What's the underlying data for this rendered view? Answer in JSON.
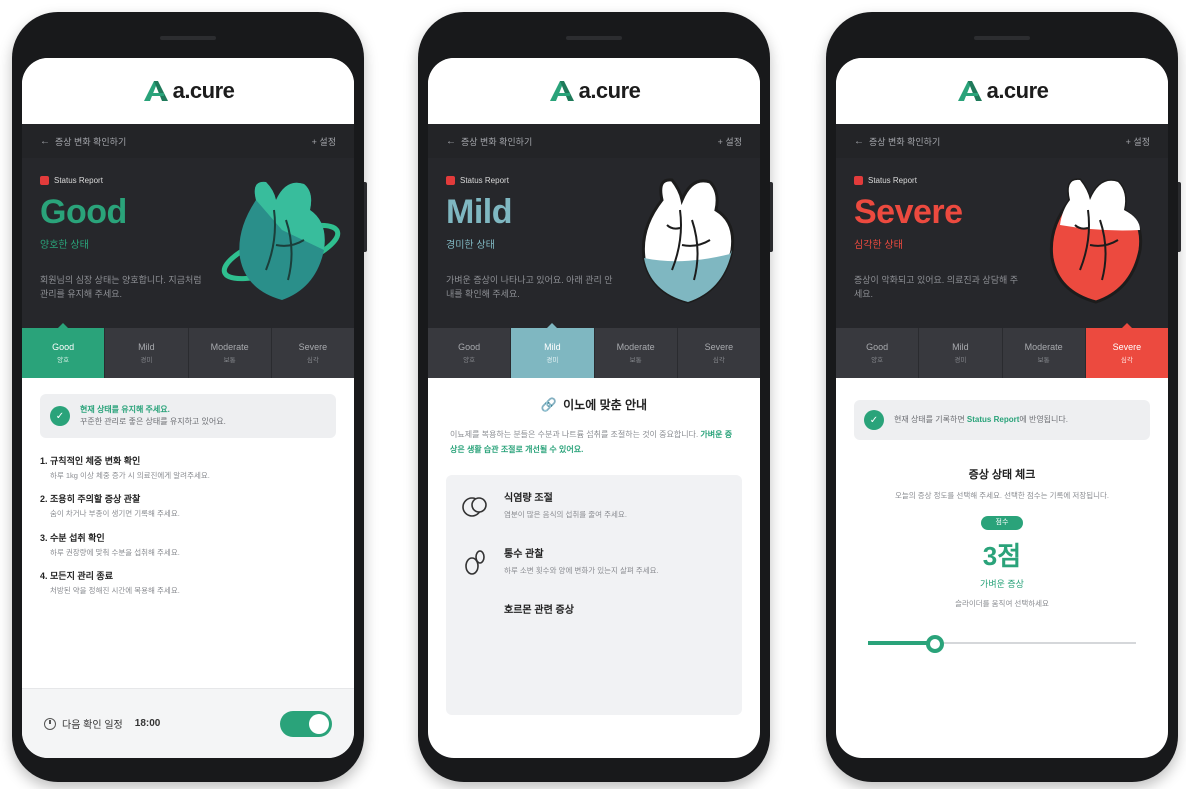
{
  "app": {
    "brand": "a.cure"
  },
  "phone1": {
    "nav_back": "증상 변화 확인하기",
    "nav_right": "+ 설정",
    "tag": "Status Report",
    "status": "Good",
    "status_sub": "양호한 상태",
    "desc": "회원님의 심장 상태는 양호합니다. 지금처럼 관리를 유지해 주세요.",
    "status_color": "#2aa37a",
    "segments": [
      {
        "label": "Good",
        "sub": "양호"
      },
      {
        "label": "Mild",
        "sub": "경미"
      },
      {
        "label": "Moderate",
        "sub": "보통"
      },
      {
        "label": "Severe",
        "sub": "심각"
      }
    ],
    "notice_title": "현재 상태를 유지해 주세요.",
    "notice_body": "꾸준한 관리로 좋은 상태를 유지하고 있어요.",
    "steps": [
      {
        "title": "1. 규칙적인 체중 변화 확인",
        "desc": "하루 1kg 이상 체중 증가 시 의료진에게 알려주세요."
      },
      {
        "title": "2. 조용히 주의할 증상 관찰",
        "desc": "숨이 차거나 부종이 생기면 기록해 주세요."
      },
      {
        "title": "3. 수분 섭취 확인",
        "desc": "하루 권장량에 맞춰 수분을 섭취해 주세요."
      },
      {
        "title": "4. 모든지 관리 종료",
        "desc": "처방된 약을 정해진 시간에 복용해 주세요."
      }
    ],
    "footer_label": "다음 확인 일정",
    "footer_time": "18:00",
    "toggle_on": true
  },
  "phone2": {
    "nav_back": "증상 변화 확인하기",
    "nav_right": "+ 설정",
    "tag": "Status Report",
    "status": "Mild",
    "status_sub": "경미한 상태",
    "desc": "가벼운 증상이 나타나고 있어요. 아래 관리 안내를 확인해 주세요.",
    "status_color": "#7fb7c1",
    "segments": [
      {
        "label": "Good",
        "sub": "양호"
      },
      {
        "label": "Mild",
        "sub": "경미"
      },
      {
        "label": "Moderate",
        "sub": "보통"
      },
      {
        "label": "Severe",
        "sub": "심각"
      }
    ],
    "guide_title": "이노에 맞춘 안내",
    "guide_desc": "이뇨제를 복용하는 분들은 수분과 나트륨 섭취를 조절하는 것이 중요합니다. ",
    "guide_desc_highlight": "가벼운 증상은 생활 습관 조절로 개선될 수 있어요.",
    "cards": [
      {
        "title": "식염량 조절",
        "desc": "염분이 많은 음식의 섭취를 줄여 주세요."
      },
      {
        "title": "통수 관찰",
        "desc": "하루 소변 횟수와 양에 변화가 있는지 살펴 주세요."
      },
      {
        "title": "호르몬 관련 증상",
        "desc": ""
      }
    ]
  },
  "phone3": {
    "nav_back": "증상 변화 확인하기",
    "nav_right": "+ 설정",
    "tag": "Status Report",
    "status": "Severe",
    "status_sub": "심각한 상태",
    "desc": "증상이 악화되고 있어요. 의료진과 상담해 주세요.",
    "status_color": "#ec4a3f",
    "segments": [
      {
        "label": "Good",
        "sub": "양호"
      },
      {
        "label": "Mild",
        "sub": "경미"
      },
      {
        "label": "Moderate",
        "sub": "보통"
      },
      {
        "label": "Severe",
        "sub": "심각"
      }
    ],
    "notice_pre": "현재 상태를 기록하면 ",
    "notice_highlight": "Status Report",
    "notice_post": "에 반영됩니다.",
    "check_title": "증상 상태 체크",
    "check_desc": "오늘의 증상 정도를 선택해 주세요. 선택한 점수는 기록에 저장됩니다.",
    "score_pill": "점수",
    "score_value": "3점",
    "score_label": "가벼운 증상",
    "score_hint": "슬라이더를 움직여 선택하세요",
    "slider_fraction": 0.25
  }
}
